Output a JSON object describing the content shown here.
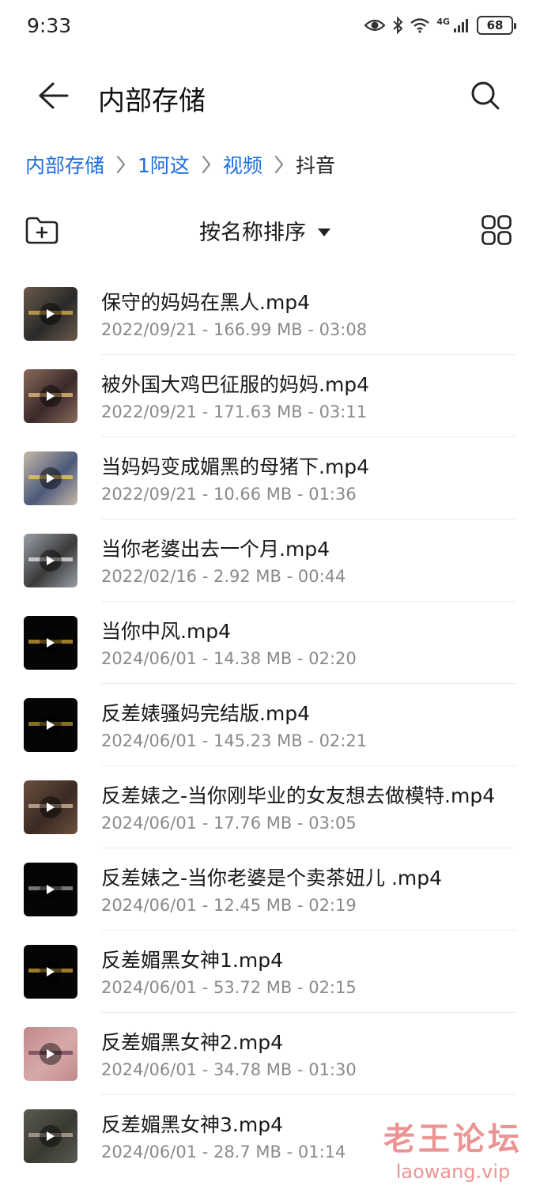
{
  "status_bar": {
    "time": "9:33",
    "network": "4G",
    "battery": "68"
  },
  "app_bar": {
    "title": "内部存储"
  },
  "breadcrumb": [
    "内部存储",
    "1阿这",
    "视频",
    "抖音"
  ],
  "toolbar": {
    "sort_label": "按名称排序"
  },
  "files": [
    {
      "name": "保守的妈妈在黑人.mp4",
      "meta": "2022/09/21 - 166.99 MB - 03:08",
      "thumb_colors": [
        "#6b5a4a",
        "#c9a24a",
        "#2a2a2a"
      ]
    },
    {
      "name": "被外国大鸡巴征服的妈妈.mp4",
      "meta": "2022/09/21 - 171.63 MB - 03:11",
      "thumb_colors": [
        "#8a6a5a",
        "#d8b070",
        "#3a2a2a"
      ]
    },
    {
      "name": "当妈妈变成媚黑的母猪下.mp4",
      "meta": "2022/09/21 - 10.66 MB - 01:36",
      "thumb_colors": [
        "#c9b8a8",
        "#e3c060",
        "#4a5a7a"
      ]
    },
    {
      "name": "当你老婆出去一个月.mp4",
      "meta": "2022/02/16 - 2.92 MB - 00:44",
      "thumb_colors": [
        "#9aa0a8",
        "#d8d8d8",
        "#3a3a3a"
      ]
    },
    {
      "name": "当你中风.mp4",
      "meta": "2024/06/01 - 14.38 MB - 02:20",
      "thumb_colors": [
        "#050505",
        "#b8902a",
        "#050505"
      ]
    },
    {
      "name": "反差婊骚妈完结版.mp4",
      "meta": "2024/06/01 - 145.23 MB - 02:21",
      "thumb_colors": [
        "#050505",
        "#a08030",
        "#050505"
      ]
    },
    {
      "name": "反差婊之-当你刚毕业的女友想去做模特.mp4",
      "meta": "2024/06/01 - 17.76 MB - 03:05",
      "thumb_colors": [
        "#6a5040",
        "#c8a890",
        "#3a2a22"
      ]
    },
    {
      "name": "反差婊之-当你老婆是个卖茶妞儿 .mp4",
      "meta": "2024/06/01 - 12.45 MB - 02:19",
      "thumb_colors": [
        "#050505",
        "#8a8a8a",
        "#050505"
      ]
    },
    {
      "name": "反差媚黑女神1.mp4",
      "meta": "2024/06/01 - 53.72 MB - 02:15",
      "thumb_colors": [
        "#050505",
        "#b89030",
        "#050505"
      ]
    },
    {
      "name": "反差媚黑女神2.mp4",
      "meta": "2024/06/01 - 34.78 MB - 01:30",
      "thumb_colors": [
        "#c08a8a",
        "#7a4a5a",
        "#d8a8a8"
      ]
    },
    {
      "name": "反差媚黑女神3.mp4",
      "meta": "2024/06/01 - 28.7 MB - 01:14",
      "thumb_colors": [
        "#5a5a52",
        "#a8a090",
        "#3a3a32"
      ]
    }
  ],
  "watermark": {
    "title": "老王论坛",
    "url": "laowang.vip"
  },
  "icons": {
    "back": "arrow-left-icon",
    "search": "search-icon",
    "new_folder": "new-folder-icon",
    "sort_dropdown": "caret-down-icon",
    "grid_view": "grid-view-icon",
    "play": "play-icon",
    "breadcrumb_separator": "chevron-right-icon"
  },
  "colors": {
    "accent": "#1f6fe0",
    "meta_text": "#8a8a8a",
    "watermark": "#dc3c3c"
  }
}
